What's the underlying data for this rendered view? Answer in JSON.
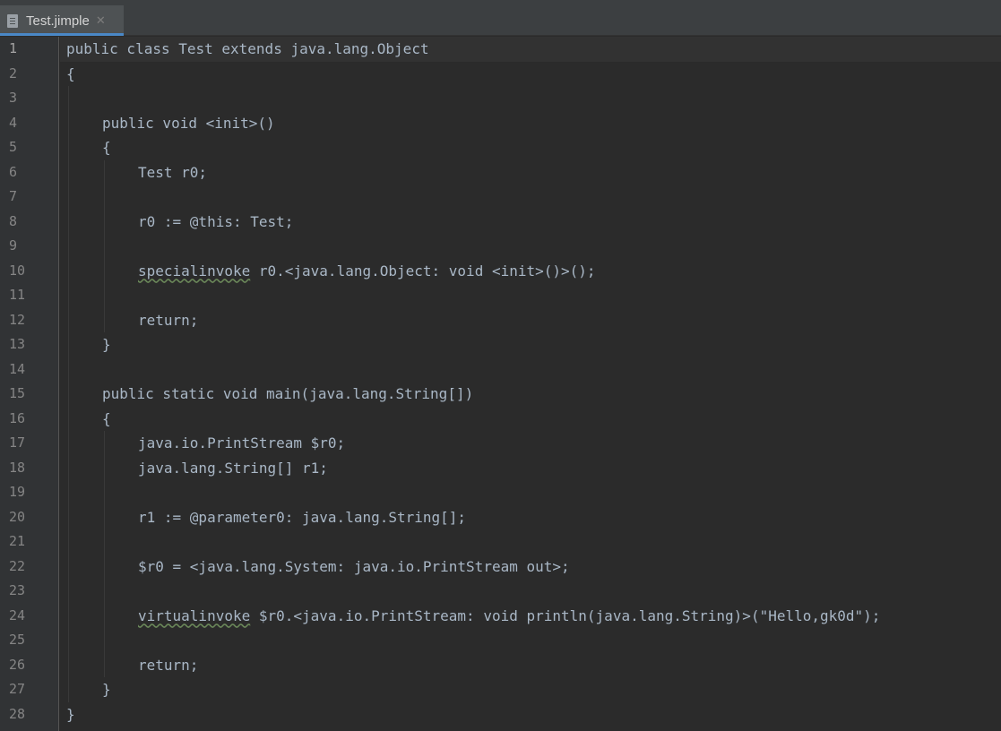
{
  "tab": {
    "label": "Test.jimple",
    "icon": "file-icon"
  },
  "lines": [
    {
      "num": "1",
      "indent": 0,
      "text": "public class Test extends java.lang.Object"
    },
    {
      "num": "2",
      "indent": 0,
      "text": "{"
    },
    {
      "num": "3",
      "indent": 0,
      "text": ""
    },
    {
      "num": "4",
      "indent": 1,
      "text": "public void <init>()"
    },
    {
      "num": "5",
      "indent": 1,
      "text": "{"
    },
    {
      "num": "6",
      "indent": 2,
      "text": "Test r0;"
    },
    {
      "num": "7",
      "indent": 0,
      "text": ""
    },
    {
      "num": "8",
      "indent": 2,
      "text": "r0 := @this: Test;"
    },
    {
      "num": "9",
      "indent": 0,
      "text": ""
    },
    {
      "num": "10",
      "indent": 2,
      "keyword": "specialinvoke",
      "text": " r0.<java.lang.Object: void <init>()>();"
    },
    {
      "num": "11",
      "indent": 0,
      "text": ""
    },
    {
      "num": "12",
      "indent": 2,
      "text": "return;"
    },
    {
      "num": "13",
      "indent": 1,
      "text": "}"
    },
    {
      "num": "14",
      "indent": 0,
      "text": ""
    },
    {
      "num": "15",
      "indent": 1,
      "text": "public static void main(java.lang.String[])"
    },
    {
      "num": "16",
      "indent": 1,
      "text": "{"
    },
    {
      "num": "17",
      "indent": 2,
      "text": "java.io.PrintStream $r0;"
    },
    {
      "num": "18",
      "indent": 2,
      "text": "java.lang.String[] r1;"
    },
    {
      "num": "19",
      "indent": 0,
      "text": ""
    },
    {
      "num": "20",
      "indent": 2,
      "text": "r1 := @parameter0: java.lang.String[];"
    },
    {
      "num": "21",
      "indent": 0,
      "text": ""
    },
    {
      "num": "22",
      "indent": 2,
      "text": "$r0 = <java.lang.System: java.io.PrintStream out>;"
    },
    {
      "num": "23",
      "indent": 0,
      "text": ""
    },
    {
      "num": "24",
      "indent": 2,
      "keyword": "virtualinvoke",
      "text": " $r0.<java.io.PrintStream: void println(java.lang.String)>(\"Hello,gk0d\");"
    },
    {
      "num": "25",
      "indent": 0,
      "text": ""
    },
    {
      "num": "26",
      "indent": 2,
      "text": "return;"
    },
    {
      "num": "27",
      "indent": 1,
      "text": "}"
    },
    {
      "num": "28",
      "indent": 0,
      "text": "}"
    }
  ],
  "colors": {
    "background": "#2b2b2b",
    "gutter": "#313335",
    "text": "#a9b7c6",
    "line_numbers": "#858585",
    "tab_accent": "#4a88c7"
  }
}
